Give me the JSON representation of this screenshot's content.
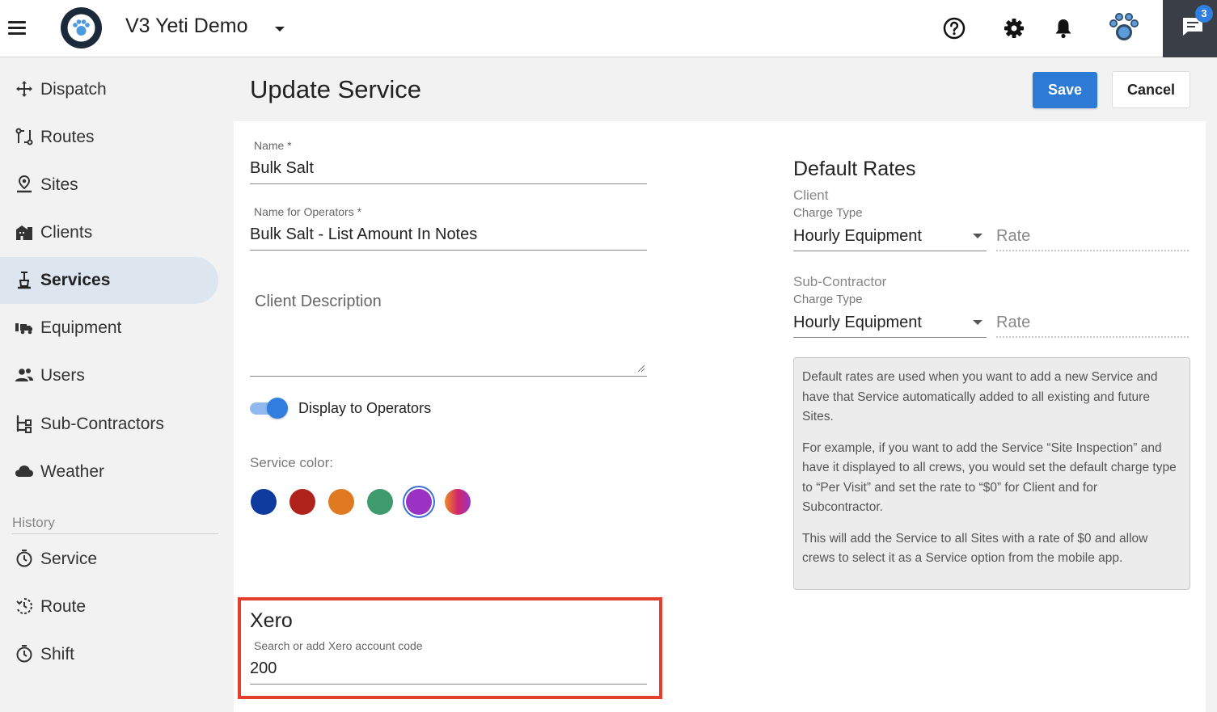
{
  "app": {
    "title": "V3 Yeti Demo",
    "notification_count": "3"
  },
  "sidebar": {
    "items": [
      {
        "label": "Dispatch",
        "icon": "move-arrows-icon"
      },
      {
        "label": "Routes",
        "icon": "route-icon"
      },
      {
        "label": "Sites",
        "icon": "site-pin-icon"
      },
      {
        "label": "Clients",
        "icon": "building-icon"
      },
      {
        "label": "Services",
        "icon": "shovel-icon",
        "active": true
      },
      {
        "label": "Equipment",
        "icon": "truck-icon"
      },
      {
        "label": "Users",
        "icon": "users-icon"
      },
      {
        "label": "Sub-Contractors",
        "icon": "org-tree-icon"
      },
      {
        "label": "Weather",
        "icon": "cloud-icon"
      }
    ],
    "history_label": "History",
    "history_items": [
      {
        "label": "Service",
        "icon": "timer-icon"
      },
      {
        "label": "Route",
        "icon": "history-icon"
      },
      {
        "label": "Shift",
        "icon": "timer-icon"
      }
    ]
  },
  "page": {
    "title": "Update Service",
    "save_label": "Save",
    "cancel_label": "Cancel"
  },
  "form": {
    "name_label": "Name  *",
    "name_value": "Bulk Salt",
    "operator_name_label": "Name for Operators  *",
    "operator_name_value": "Bulk Salt - List Amount In Notes",
    "client_description_placeholder": "Client Description",
    "display_to_operators_label": "Display to Operators",
    "display_to_operators": true,
    "service_color_label": "Service color:",
    "colors": [
      "#0f3a9e",
      "#b0231c",
      "#e07a22",
      "#3f9a6e",
      "#9a33c4",
      "gradient-orange-purple"
    ],
    "selected_color_index": 4,
    "xero_title": "Xero",
    "xero_label": "Search or add Xero account code",
    "xero_value": "200"
  },
  "default_rates": {
    "title": "Default Rates",
    "client": {
      "section": "Client",
      "charge_type_label": "Charge Type",
      "charge_type_value": "Hourly Equipment",
      "rate_placeholder": "Rate"
    },
    "subcontractor": {
      "section": "Sub-Contractor",
      "charge_type_label": "Charge Type",
      "charge_type_value": "Hourly Equipment",
      "rate_placeholder": "Rate"
    },
    "info": {
      "p1": "Default rates are used when you want to add a new Service and have that Service automatically added to all existing and future Sites.",
      "p2": "For example, if you want to add the Service “Site Inspection” and have it displayed to all crews, you would set the default charge type to “Per Visit” and set the rate to “$0” for Client and for Subcontractor.",
      "p3": "This will add the Service to all Sites with a rate of $0 and allow crews to select it as a Service option from the mobile app."
    }
  },
  "colors": {
    "accent": "#2e7bd6",
    "highlight_box": "#e5402e",
    "active_nav": "#dde5ef"
  }
}
